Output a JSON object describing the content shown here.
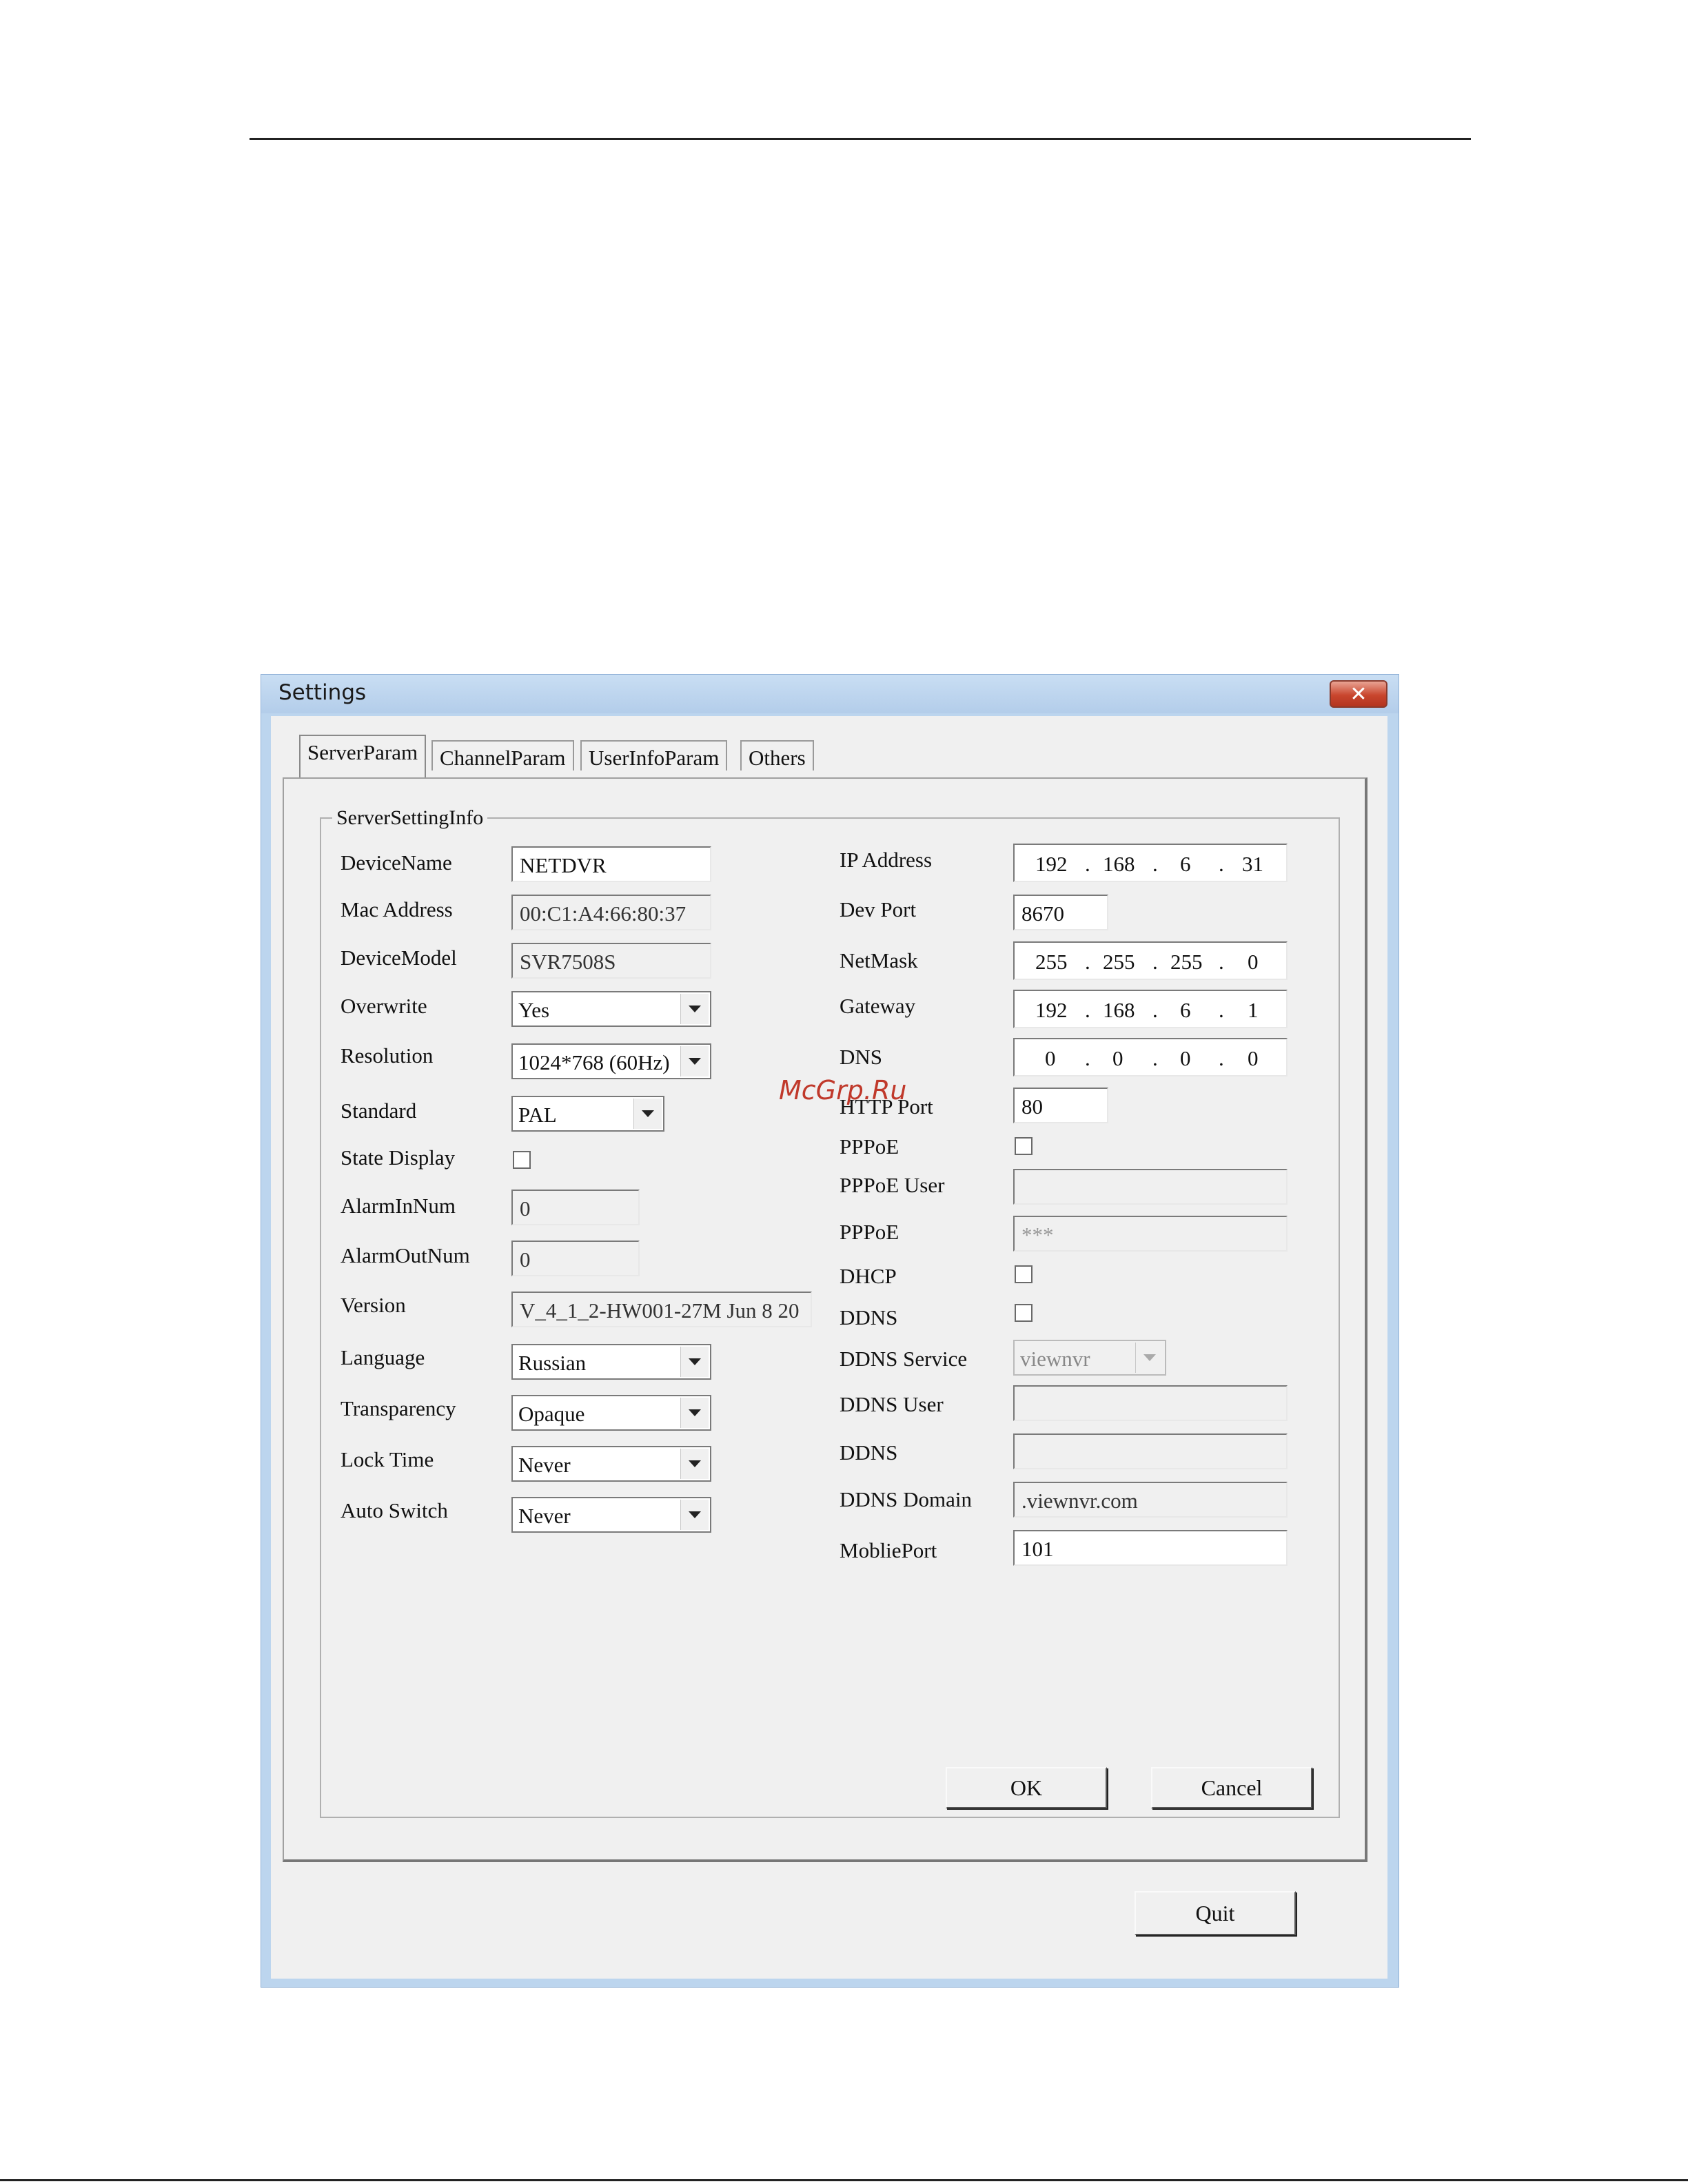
{
  "window": {
    "title": "Settings",
    "close_symbol": "✕",
    "quit_label": "Quit"
  },
  "tabs": [
    "ServerParam",
    "ChannelParam",
    "UserInfoParam",
    "Others"
  ],
  "group_title": "ServerSettingInfo",
  "left": {
    "device_name": {
      "label": "DeviceName",
      "value": "NETDVR"
    },
    "mac_address": {
      "label": "Mac Address",
      "value": "00:C1:A4:66:80:37"
    },
    "device_model": {
      "label": "DeviceModel",
      "value": "SVR7508S"
    },
    "overwrite": {
      "label": "Overwrite",
      "value": "Yes"
    },
    "resolution": {
      "label": "Resolution",
      "value": "1024*768 (60Hz)"
    },
    "standard": {
      "label": "Standard",
      "value": "PAL"
    },
    "state_display": {
      "label": "State Display"
    },
    "alarm_in": {
      "label": "AlarmInNum",
      "value": "0"
    },
    "alarm_out": {
      "label": "AlarmOutNum",
      "value": "0"
    },
    "version": {
      "label": "Version",
      "value": "V_4_1_2-HW001-27M Jun 8 20"
    },
    "language": {
      "label": "Language",
      "value": "Russian"
    },
    "transparency": {
      "label": "Transparency",
      "value": "Opaque"
    },
    "lock_time": {
      "label": "Lock Time",
      "value": "Never"
    },
    "auto_switch": {
      "label": "Auto Switch",
      "value": "Never"
    }
  },
  "right": {
    "ip_address": {
      "label": "IP Address",
      "octets": [
        "192",
        "168",
        "6",
        "31"
      ]
    },
    "dev_port": {
      "label": "Dev Port",
      "value": "8670"
    },
    "netmask": {
      "label": "NetMask",
      "octets": [
        "255",
        "255",
        "255",
        "0"
      ]
    },
    "gateway": {
      "label": "Gateway",
      "octets": [
        "192",
        "168",
        "6",
        "1"
      ]
    },
    "dns": {
      "label": "DNS",
      "octets": [
        "0",
        "0",
        "0",
        "0"
      ]
    },
    "http_port": {
      "label": "HTTP Port",
      "value": "80"
    },
    "pppoe": {
      "label": "PPPoE"
    },
    "pppoe_user": {
      "label": "PPPoE User",
      "value": ""
    },
    "pppoe_password": {
      "label": "PPPoE",
      "value": "***"
    },
    "dhcp": {
      "label": "DHCP"
    },
    "ddns": {
      "label": "DDNS"
    },
    "ddns_service": {
      "label": "DDNS Service",
      "value": "viewnvr"
    },
    "ddns_user": {
      "label": "DDNS User",
      "value": ""
    },
    "ddns_password": {
      "label": "DDNS",
      "value": ""
    },
    "ddns_domain": {
      "label": "DDNS Domain",
      "value": ".viewnvr.com"
    },
    "mobile_port": {
      "label": "MobliePort",
      "value": "101"
    }
  },
  "buttons": {
    "ok": "OK",
    "cancel": "Cancel"
  },
  "ip_separator": ".",
  "watermark": "McGrp.Ru"
}
